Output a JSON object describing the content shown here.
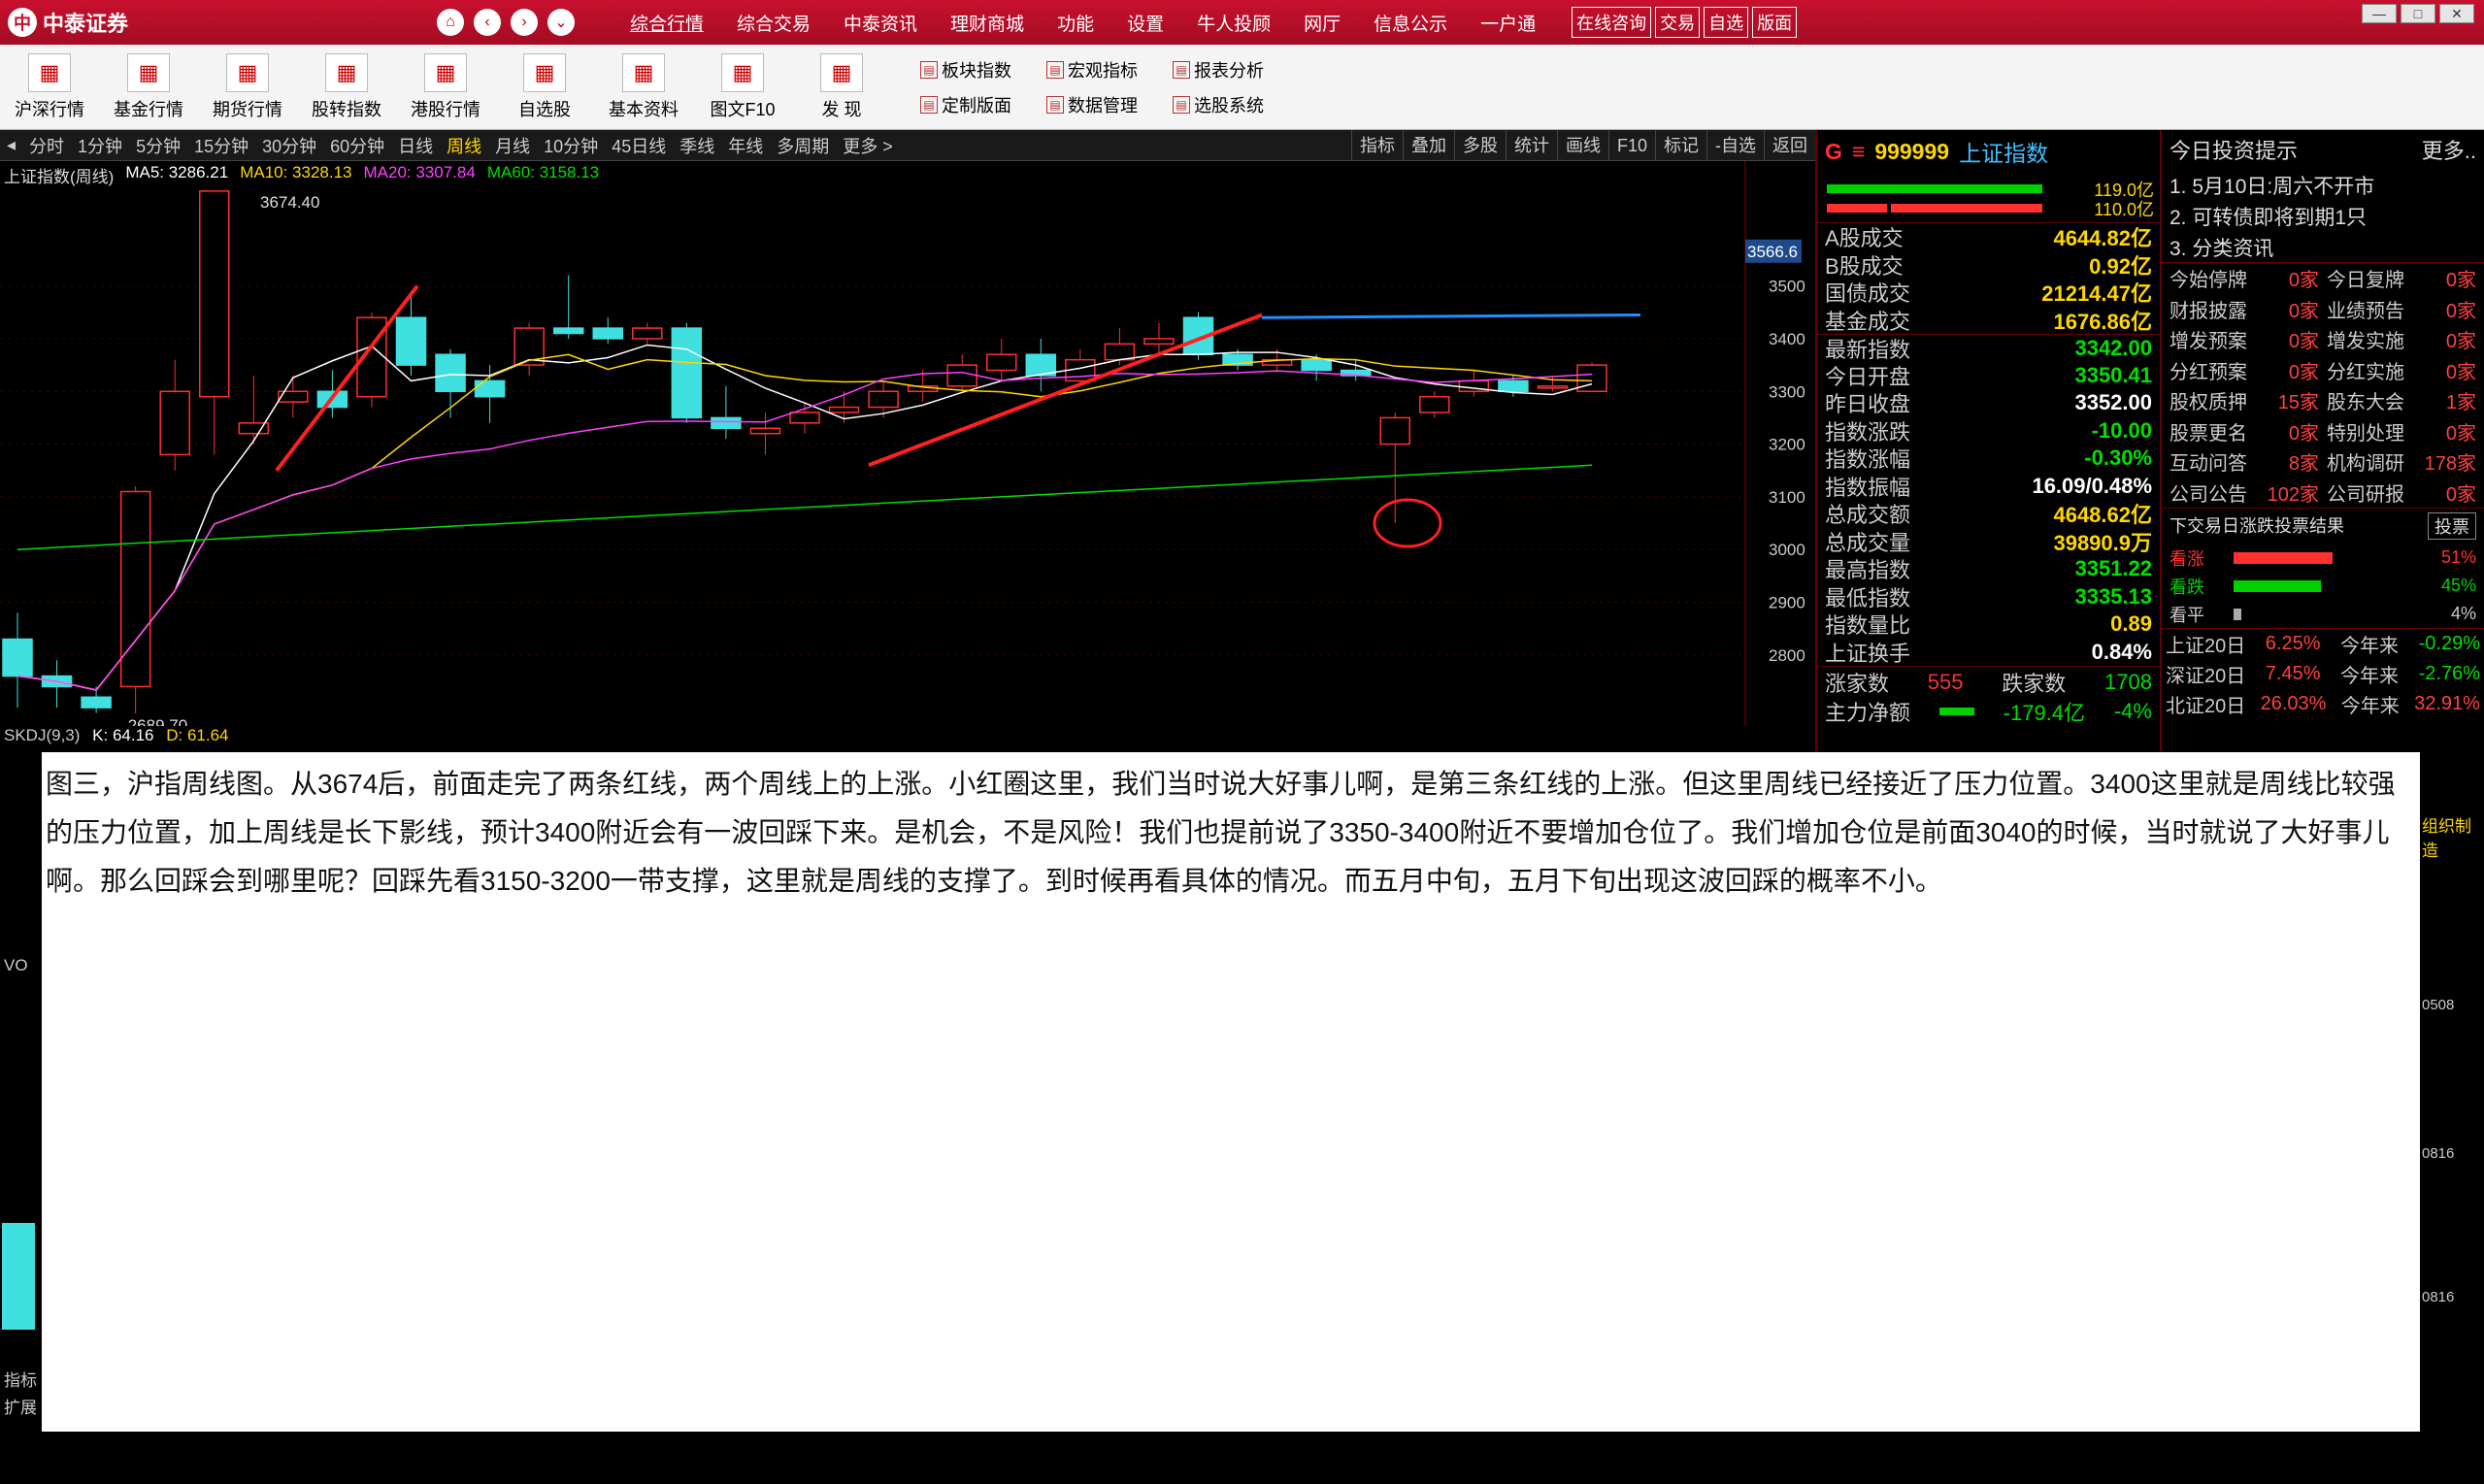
{
  "app": {
    "logo": "中泰证券",
    "logo_glyph": "中"
  },
  "topmenu": [
    "综合行情",
    "综合交易",
    "中泰资讯",
    "理财商城",
    "功能",
    "设置",
    "牛人投顾",
    "网厅",
    "信息公示",
    "一户通"
  ],
  "topbuttons": [
    "在线咨询",
    "交易",
    "自选",
    "版面"
  ],
  "toolbar": [
    {
      "label": "沪深行情"
    },
    {
      "label": "基金行情"
    },
    {
      "label": "期货行情"
    },
    {
      "label": "股转指数"
    },
    {
      "label": "港股行情"
    },
    {
      "label": "自选股"
    },
    {
      "label": "基本资料"
    },
    {
      "label": "图文F10"
    },
    {
      "label": "发 现"
    }
  ],
  "smalltools": [
    "板块指数",
    "宏观指标",
    "报表分析",
    "定制版面",
    "数据管理",
    "选股系统"
  ],
  "periods": [
    "分时",
    "1分钟",
    "5分钟",
    "15分钟",
    "30分钟",
    "60分钟",
    "日线",
    "周线",
    "月线",
    "10分钟",
    "45日线",
    "季线",
    "年线",
    "多周期",
    "更多 >"
  ],
  "active_period": "周线",
  "chart_tools": [
    "指标",
    "叠加",
    "多股",
    "统计",
    "画线",
    "F10",
    "标记",
    "-自选",
    "返回"
  ],
  "legend": {
    "name": "上证指数(周线)",
    "ma5": "MA5: 3286.21",
    "ma10": "MA10: 3328.13",
    "ma20": "MA20: 3307.84",
    "ma60": "MA60: 3158.13"
  },
  "annotations": {
    "high": "3674.40",
    "low": "2689.70",
    "tag": "3566.6"
  },
  "indicator": {
    "name": "SKDJ(9,3)",
    "k": "K: 64.16",
    "d": "D: 61.64"
  },
  "chart_data": {
    "type": "candlestick",
    "ylabels": [
      "3500",
      "3400",
      "3300",
      "3200",
      "3100",
      "3000",
      "2900",
      "2800"
    ],
    "ylim": [
      2680,
      3700
    ]
  },
  "quote": {
    "code": "999999",
    "name": "上证指数",
    "mark": "G",
    "bars": [
      "119.0亿",
      "110.0亿"
    ],
    "rows": [
      {
        "l": "A股成交",
        "v": "4644.82亿",
        "c": "#ffd700"
      },
      {
        "l": "B股成交",
        "v": "0.92亿",
        "c": "#ffd700"
      },
      {
        "l": "国债成交",
        "v": "21214.47亿",
        "c": "#ffd700"
      },
      {
        "l": "基金成交",
        "v": "1676.86亿",
        "c": "#ffd700"
      },
      {
        "l": "最新指数",
        "v": "3342.00",
        "c": "#00e000"
      },
      {
        "l": "今日开盘",
        "v": "3350.41",
        "c": "#00e000"
      },
      {
        "l": "昨日收盘",
        "v": "3352.00",
        "c": "#fff"
      },
      {
        "l": "指数涨跌",
        "v": "-10.00",
        "c": "#00e000"
      },
      {
        "l": "指数涨幅",
        "v": "-0.30%",
        "c": "#00e000"
      },
      {
        "l": "指数振幅",
        "v": "16.09/0.48%",
        "c": "#fff"
      },
      {
        "l": "总成交额",
        "v": "4648.62亿",
        "c": "#ffd700"
      },
      {
        "l": "总成交量",
        "v": "39890.9万",
        "c": "#ffd700"
      },
      {
        "l": "最高指数",
        "v": "3351.22",
        "c": "#00e000"
      },
      {
        "l": "最低指数",
        "v": "3335.13",
        "c": "#00e000"
      },
      {
        "l": "指数量比",
        "v": "0.89",
        "c": "#ffd700"
      },
      {
        "l": "上证换手",
        "v": "0.84%",
        "c": "#fff"
      }
    ],
    "updown": {
      "up_label": "涨家数",
      "up": "555",
      "down_label": "跌家数",
      "down": "1708"
    },
    "flow": {
      "label": "主力净额",
      "v": "-179.4亿",
      "p": "-4%"
    }
  },
  "info": {
    "title": "今日投资提示",
    "more": "更多..",
    "notes": [
      "1. 5月10日:周六不开市",
      "2. 可转债即将到期1只",
      "3. 分类资讯"
    ],
    "grid": [
      [
        "今始停牌",
        "0家"
      ],
      [
        "今日复牌",
        "0家"
      ],
      [
        "财报披露",
        "0家"
      ],
      [
        "业绩预告",
        "0家"
      ],
      [
        "增发预案",
        "0家"
      ],
      [
        "增发实施",
        "0家"
      ],
      [
        "分红预案",
        "0家"
      ],
      [
        "分红实施",
        "0家"
      ],
      [
        "股权质押",
        "15家"
      ],
      [
        "股东大会",
        "1家"
      ],
      [
        "股票更名",
        "0家"
      ],
      [
        "特别处理",
        "0家"
      ],
      [
        "互动问答",
        "8家"
      ],
      [
        "机构调研",
        "178家"
      ],
      [
        "公司公告",
        "102家"
      ],
      [
        "公司研报",
        "0家"
      ]
    ],
    "vote_title": "下交易日涨跌投票结果",
    "vote_btn": "投票",
    "votes": [
      {
        "l": "看涨",
        "p": "51%",
        "v": 0.51,
        "c": "#ff3030"
      },
      {
        "l": "看跌",
        "p": "45%",
        "v": 0.45,
        "c": "#00d000"
      },
      {
        "l": "看平",
        "p": "4%",
        "v": 0.04,
        "c": "#aaa"
      }
    ],
    "perf": [
      {
        "l": "上证20日",
        "a": "6.25%",
        "l2": "今年来",
        "b": "-0.29%"
      },
      {
        "l": "深证20日",
        "a": "7.45%",
        "l2": "今年来",
        "b": "-2.76%"
      },
      {
        "l": "北证20日",
        "a": "26.03%",
        "l2": "今年来",
        "b": "32.91%"
      }
    ]
  },
  "caption": "图三，沪指周线图。从3674后，前面走完了两条红线，两个周线上的上涨。小红圈这里，我们当时说大好事儿啊，是第三条红线的上涨。但这里周线已经接近了压力位置。3400这里就是周线比较强的压力位置，加上周线是长下影线，预计3400附近会有一波回踩下来。是机会，不是风险！我们也提前说了3350-3400附近不要增加仓位了。我们增加仓位是前面3040的时候，当时就说了大好事儿啊。那么回踩会到哪里呢？回踩先看3150-3200一带支撑，这里就是周线的支撑了。到时候再看具体的情况。而五月中旬，五月下旬出现这波回踩的概率不小。",
  "side_fragments": {
    "vo": "VO",
    "label1": "指标",
    "label2": "扩展",
    "right1": "组织制造",
    "r2": "0508",
    "r3": "0816",
    "r4": "0816"
  }
}
